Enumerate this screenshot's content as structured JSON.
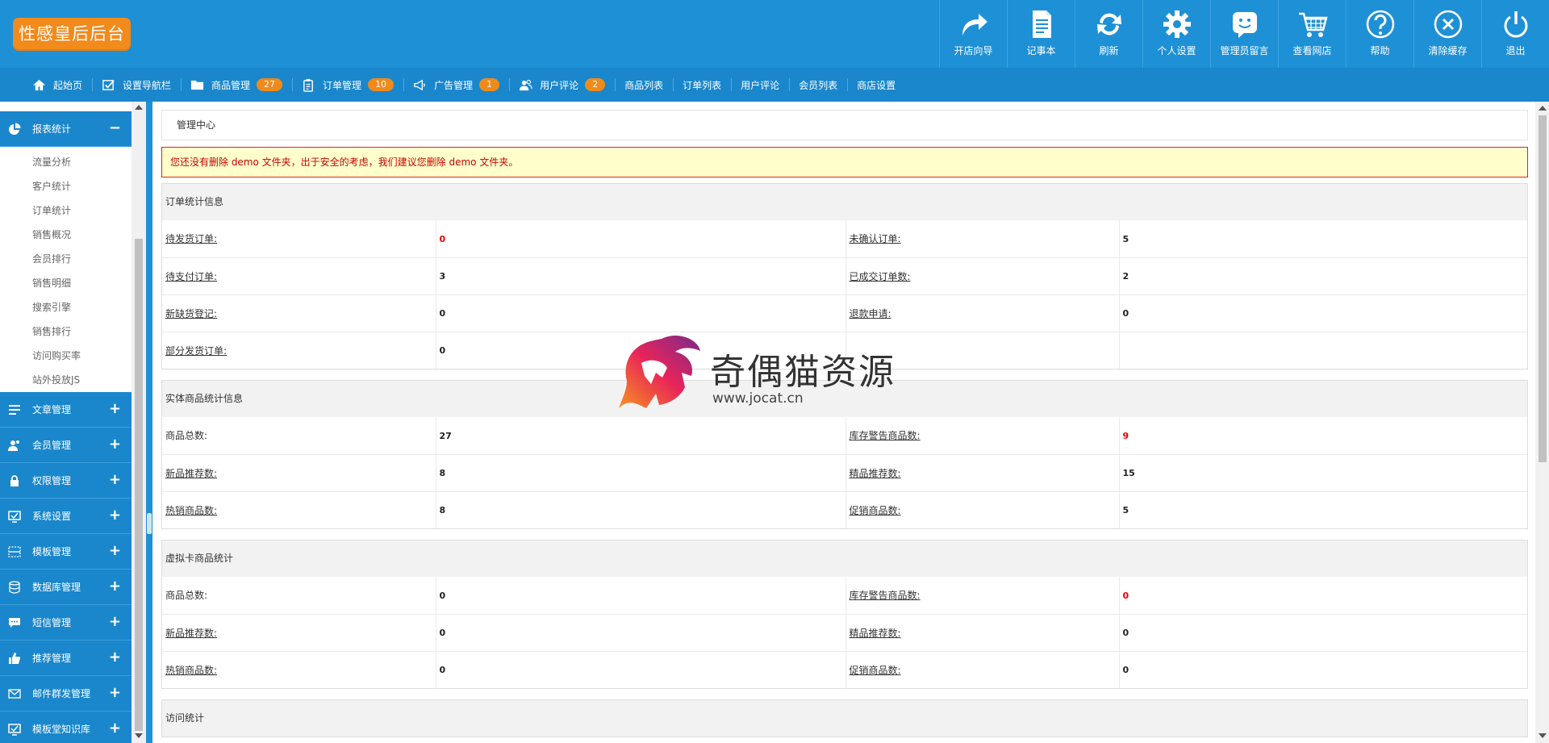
{
  "app": {
    "logo": "性感皇后后台"
  },
  "colors": {
    "header_bg": "#1e90d6",
    "accent": "#f08a1a",
    "warning_text": "#c80000",
    "warning_bg": "#ffffcc"
  },
  "top_actions": [
    {
      "label": "开店向导",
      "icon": "share-arrow-icon"
    },
    {
      "label": "记事本",
      "icon": "notepad-icon"
    },
    {
      "label": "刷新",
      "icon": "refresh-icon"
    },
    {
      "label": "个人设置",
      "icon": "gear-icon"
    },
    {
      "label": "管理员留言",
      "icon": "message-smile-icon"
    },
    {
      "label": "查看网店",
      "icon": "cart-icon"
    },
    {
      "label": "帮助",
      "icon": "help-icon"
    },
    {
      "label": "清除缓存",
      "icon": "clear-icon"
    },
    {
      "label": "退出",
      "icon": "power-icon"
    }
  ],
  "nav": {
    "home": "起始页",
    "set_nav": "设置导航栏",
    "goods": {
      "label": "商品管理",
      "count": "27"
    },
    "orders": {
      "label": "订单管理",
      "count": "10"
    },
    "ads": {
      "label": "广告管理",
      "count": "1"
    },
    "comments": {
      "label": "用户评论",
      "count": "2"
    },
    "links": [
      "商品列表",
      "订单列表",
      "用户评论",
      "会员列表",
      "商店设置"
    ]
  },
  "sidebar": {
    "open_section": {
      "label": "报表统计",
      "toggle": "−"
    },
    "sub_items": [
      "流量分析",
      "客户统计",
      "订单统计",
      "销售概况",
      "会员排行",
      "销售明细",
      "搜索引擎",
      "销售排行",
      "访问购买率",
      "站外投放JS"
    ],
    "sections": [
      {
        "label": "文章管理",
        "toggle": "+"
      },
      {
        "label": "会员管理",
        "toggle": "+"
      },
      {
        "label": "权限管理",
        "toggle": "+"
      },
      {
        "label": "系统设置",
        "toggle": "+"
      },
      {
        "label": "模板管理",
        "toggle": "+"
      },
      {
        "label": "数据库管理",
        "toggle": "+"
      },
      {
        "label": "短信管理",
        "toggle": "+"
      },
      {
        "label": "推荐管理",
        "toggle": "+"
      },
      {
        "label": "邮件群发管理",
        "toggle": "+"
      },
      {
        "label": "模板堂知识库",
        "toggle": "+"
      }
    ]
  },
  "main": {
    "breadcrumb": "管理中心",
    "warning": "您还没有删除 demo 文件夹，出于安全的考虑，我们建议您删除 demo 文件夹。",
    "order_stats": {
      "title": "订单统计信息",
      "rows": [
        [
          "待发货订单:",
          "0",
          "未确认订单:",
          "5"
        ],
        [
          "待支付订单:",
          "3",
          "已成交订单数:",
          "2"
        ],
        [
          "新缺货登记:",
          "0",
          "退款申请:",
          "0"
        ],
        [
          "部分发货订单:",
          "0",
          "",
          ""
        ]
      ]
    },
    "goods_stats": {
      "title": "实体商品统计信息",
      "rows": [
        [
          "商品总数:",
          "27",
          "库存警告商品数:",
          "9"
        ],
        [
          "新品推荐数:",
          "8",
          "精品推荐数:",
          "15"
        ],
        [
          "热销商品数:",
          "8",
          "促销商品数:",
          "5"
        ]
      ]
    },
    "virtual_stats": {
      "title": "虚拟卡商品统计",
      "rows": [
        [
          "商品总数:",
          "0",
          "库存警告商品数:",
          "0"
        ],
        [
          "新品推荐数:",
          "0",
          "精品推荐数:",
          "0"
        ],
        [
          "热销商品数:",
          "0",
          "促销商品数:",
          "0"
        ]
      ]
    },
    "visit_stats": {
      "title": "访问统计"
    }
  },
  "watermark": {
    "name": "奇偶猫资源",
    "url": "www.jocat.cn"
  }
}
